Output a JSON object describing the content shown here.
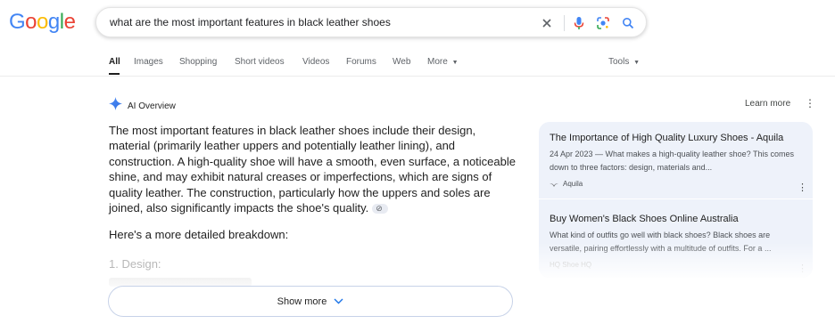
{
  "search": {
    "query": "what are the most important features in black leather shoes"
  },
  "logo": {
    "letters": [
      "G",
      "o",
      "o",
      "g",
      "l",
      "e"
    ],
    "colors": [
      "#4285F4",
      "#EA4335",
      "#FBBC05",
      "#4285F4",
      "#34A853",
      "#EA4335"
    ]
  },
  "tabs": [
    {
      "label": "All",
      "active": true
    },
    {
      "label": "Images"
    },
    {
      "label": "Shopping"
    },
    {
      "label": "Short videos"
    },
    {
      "label": "Videos"
    },
    {
      "label": "Forums"
    },
    {
      "label": "Web"
    },
    {
      "label": "More"
    }
  ],
  "tools_label": "Tools",
  "ai_overview": {
    "title": "AI Overview",
    "learn_more": "Learn more",
    "paragraph": "The most important features in black leather shoes include their design, material (primarily leather uppers and potentially leather lining), and construction. A high-quality shoe will have a smooth, even surface, a noticeable shine, and may exhibit natural creases or imperfections, which are signs of quality leather. The construction, particularly how the uppers and soles are joined, also significantly impacts the shoe's quality.",
    "breakdown": "Here's a more detailed breakdown:",
    "design_heading": "1. Design:",
    "show_more": "Show more"
  },
  "sources": [
    {
      "title": "The Importance of High Quality Luxury Shoes - Aquila",
      "snippet": "24 Apr 2023 — What makes a high-quality leather shoe? This comes down to three factors: design, materials and...",
      "site": "Aquila"
    },
    {
      "title": "Buy Women's Black Shoes Online Australia",
      "snippet": "What kind of outfits go well with black shoes? Black shoes are versatile, pairing effortlessly with a multitude of outfits. For a ...",
      "site": "HQ Shoe HQ"
    }
  ],
  "colors": {
    "accent_blue": "#1a73e8",
    "card_bg": "#eef2fa",
    "ai_spark": "#3b78e7"
  },
  "icons": [
    "clear-icon",
    "voice-search-icon",
    "lens-icon",
    "search-icon",
    "ai-spark-icon",
    "chevron-down-icon",
    "more-vert-icon"
  ]
}
